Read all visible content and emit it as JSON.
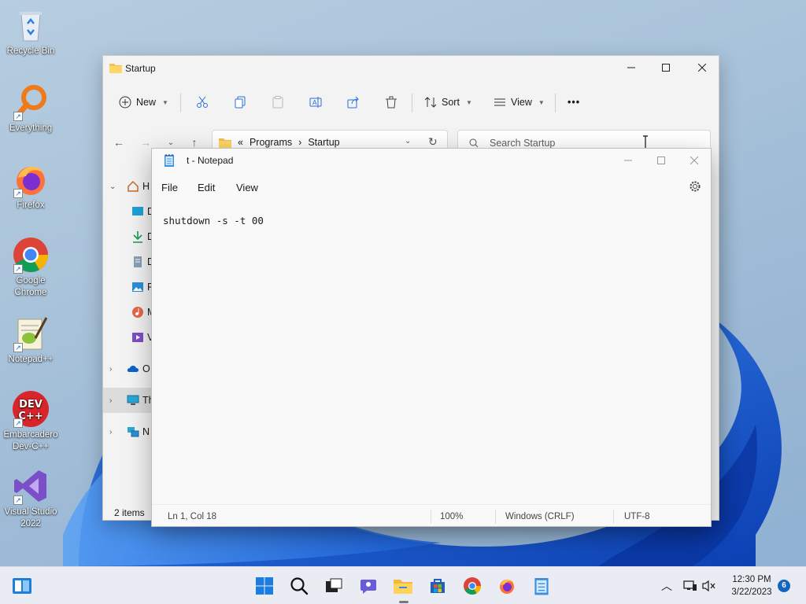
{
  "desktop": {
    "icons": [
      {
        "label": "Recycle Bin",
        "icon": "recycle-bin-icon"
      },
      {
        "label": "Everything",
        "icon": "everything-icon"
      },
      {
        "label": "Firefox",
        "icon": "firefox-icon"
      },
      {
        "label": "Google Chrome",
        "icon": "chrome-icon"
      },
      {
        "label": "Notepad++",
        "icon": "notepad-plus-plus-icon"
      },
      {
        "label": "Embarcadero Dev-C++",
        "icon": "dev-cpp-icon"
      },
      {
        "label": "Visual Studio 2022",
        "icon": "visual-studio-icon"
      }
    ]
  },
  "explorer": {
    "title": "Startup",
    "toolbar": {
      "new_label": "New",
      "sort_label": "Sort",
      "view_label": "View",
      "more_label": "•••"
    },
    "address": {
      "overflow": "«",
      "crumbs": [
        "Programs",
        "Startup"
      ]
    },
    "search": {
      "placeholder": "Search Startup"
    },
    "nav": {
      "home_label": "H",
      "onedrive_label": "O",
      "thispc_label": "Th",
      "network_label": "N",
      "items": [
        {
          "label": "D",
          "icon": "desktop-icon"
        },
        {
          "label": "D",
          "icon": "downloads-icon"
        },
        {
          "label": "D",
          "icon": "documents-icon"
        },
        {
          "label": "P",
          "icon": "pictures-icon"
        },
        {
          "label": "M",
          "icon": "music-icon"
        },
        {
          "label": "V",
          "icon": "videos-icon"
        }
      ]
    },
    "status": {
      "items": "2 items"
    }
  },
  "notepad": {
    "title": "t - Notepad",
    "menu": {
      "file": "File",
      "edit": "Edit",
      "view": "View"
    },
    "content": "shutdown -s -t 00",
    "status": {
      "position": "Ln 1, Col 18",
      "zoom": "100%",
      "line_ending": "Windows (CRLF)",
      "encoding": "UTF-8"
    }
  },
  "taskbar": {
    "apps": [
      "start-icon",
      "search-icon",
      "task-view-icon",
      "chat-icon",
      "file-explorer-icon",
      "store-icon",
      "chrome-icon",
      "firefox-icon",
      "notepad-icon"
    ],
    "clock_time": "12:30 PM",
    "clock_date": "3/22/2023",
    "notification_count": "6"
  },
  "colors": {
    "accent": "#0067c0",
    "folder": "#f2c14e",
    "wallpaper_bloom": "#1a5fd8"
  }
}
